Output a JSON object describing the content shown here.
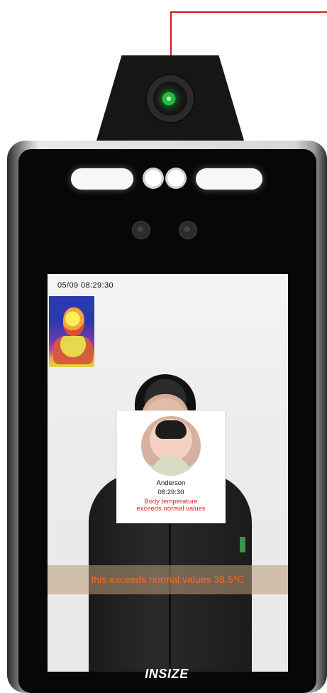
{
  "screen": {
    "datetime": "05/09  08:29:30",
    "recognition_card": {
      "name": "Anderson",
      "time": "08:29:30",
      "alert_line1": "Body temperature",
      "alert_line2": "exceeds normal values"
    },
    "warning_banner": "this exceeds normal values 38.5℃"
  },
  "device": {
    "brand_logo": "INSIZE"
  },
  "colors": {
    "alert_red": "#e0251f",
    "warning_orange": "#f06b2d",
    "annotation_red": "#d0191f",
    "lens_green": "#27b84a"
  },
  "icons": {
    "thermal_preview": "thermal-camera-thumbnail",
    "camera": "camera-icon",
    "sensor": "sensor-icon"
  }
}
